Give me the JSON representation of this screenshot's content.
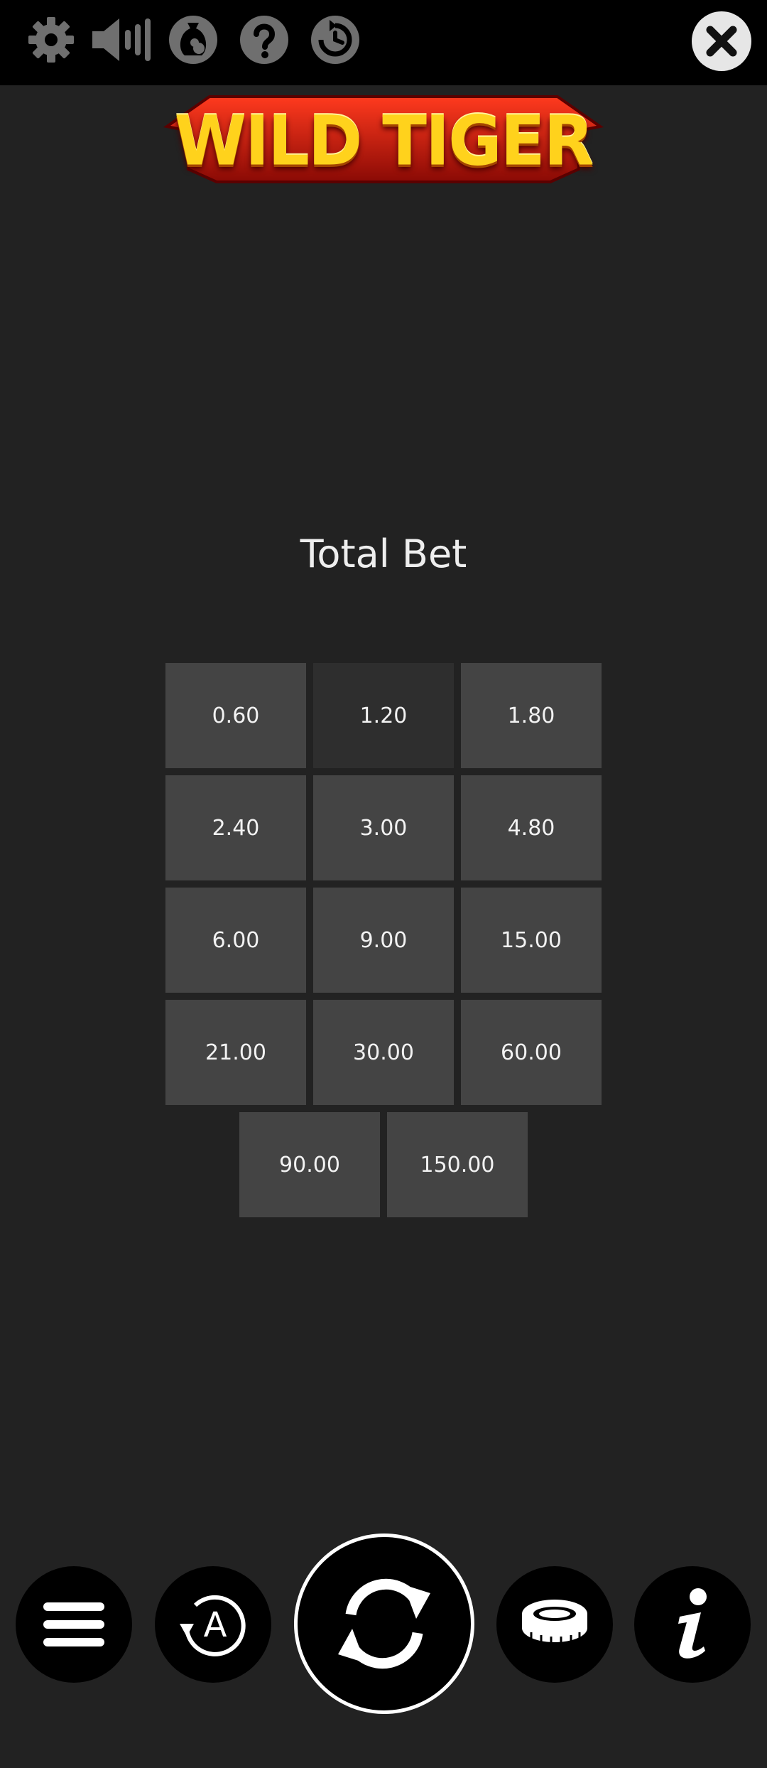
{
  "top_bar": {
    "icons": [
      "gear-icon",
      "volume-icon",
      "money-bag-icon",
      "help-icon",
      "history-icon"
    ],
    "close_icon": "close-icon"
  },
  "logo": {
    "text": "WILD TIGER"
  },
  "bet_panel": {
    "title": "Total Bet",
    "options": [
      "0.60",
      "1.20",
      "1.80",
      "2.40",
      "3.00",
      "4.80",
      "6.00",
      "9.00",
      "15.00",
      "21.00",
      "30.00",
      "60.00",
      "90.00",
      "150.00"
    ],
    "selected": "1.20"
  },
  "bottom_bar": {
    "buttons": [
      "menu-icon",
      "autoplay-icon",
      "spin-icon",
      "coin-stack-icon",
      "info-icon"
    ]
  },
  "colors": {
    "background": "#222222",
    "top_bar": "#000000",
    "bet_button": "#444444",
    "bet_button_selected": "#2e2e2e",
    "logo_gold": "#ffd21c",
    "logo_red": "#c4160b"
  }
}
